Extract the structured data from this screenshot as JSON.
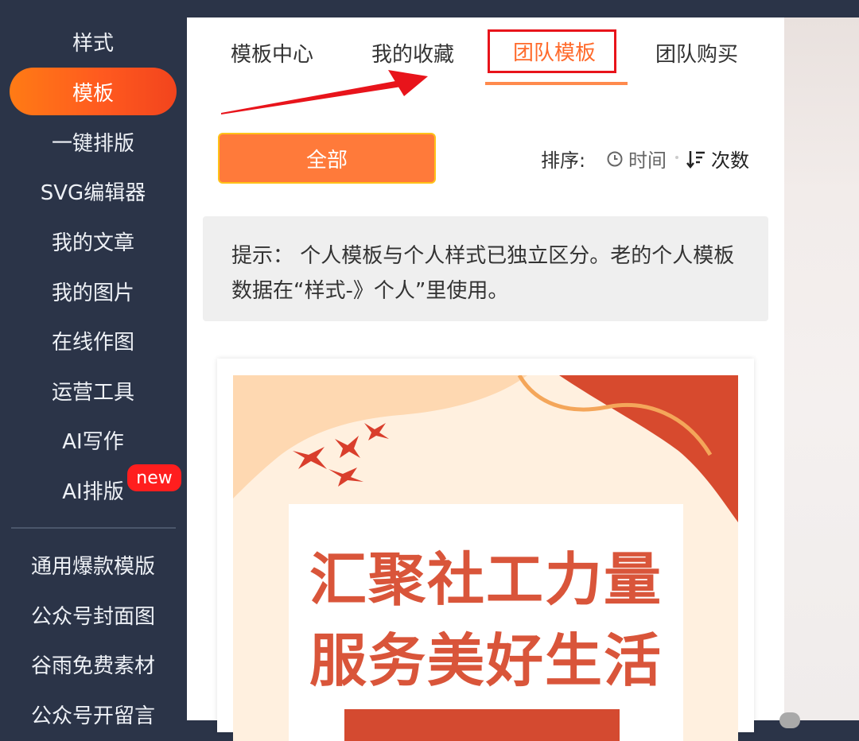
{
  "sidebar": {
    "items": [
      {
        "label": "样式"
      },
      {
        "label": "模板"
      },
      {
        "label": "一键排版"
      },
      {
        "label": "SVG编辑器"
      },
      {
        "label": "我的文章"
      },
      {
        "label": "我的图片"
      },
      {
        "label": "在线作图"
      },
      {
        "label": "运营工具"
      },
      {
        "label": "AI写作"
      },
      {
        "label": "AI排版"
      }
    ],
    "active_index": 1,
    "new_badge": "new",
    "secondary_items": [
      {
        "label": "通用爆款模版"
      },
      {
        "label": "公众号封面图"
      },
      {
        "label": "谷雨免费素材"
      },
      {
        "label": "公众号开留言"
      }
    ]
  },
  "tabs": [
    {
      "label": "模板中心"
    },
    {
      "label": "我的收藏"
    },
    {
      "label": "团队模板"
    },
    {
      "label": "团队购买"
    }
  ],
  "active_tab_index": 2,
  "filter": {
    "all_label": "全部",
    "sort_label": "排序:",
    "sort_time": "时间",
    "sort_count": "次数"
  },
  "tip": {
    "text": "提示： 个人模板与个人样式已独立区分。老的个人模板数据在“样式-》个人”里使用。"
  },
  "template_card": {
    "line1": "汇聚社工力量",
    "line2": "服务美好生活"
  },
  "colors": {
    "sidebar_bg": "#2b3448",
    "accent": "#ff6a2b",
    "highlight_red": "#e8141b",
    "card_red": "#d9553a"
  }
}
